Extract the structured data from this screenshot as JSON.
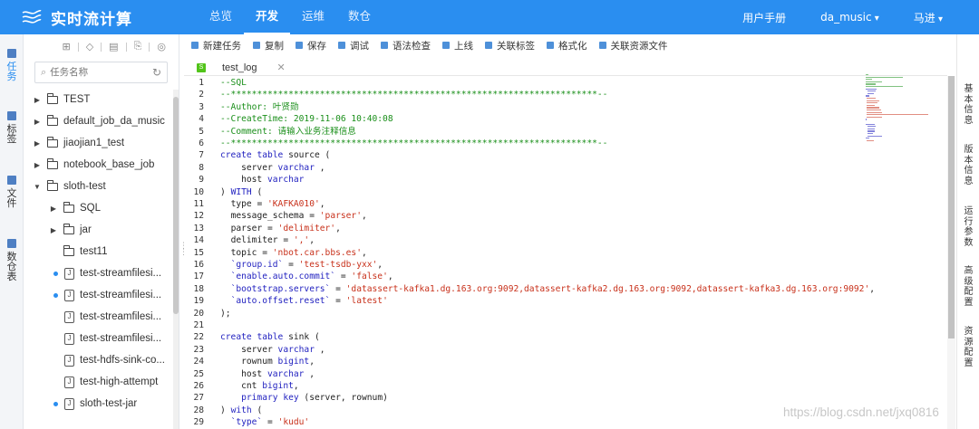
{
  "app": {
    "title": "实时流计算"
  },
  "topnav": [
    {
      "label": "总览",
      "active": false
    },
    {
      "label": "开发",
      "active": true
    },
    {
      "label": "运维",
      "active": false
    },
    {
      "label": "数仓",
      "active": false
    }
  ],
  "header_right": {
    "manual": "用户手册",
    "project": "da_music",
    "user": "马进"
  },
  "rail": [
    {
      "label": "任务",
      "icon": "task-icon",
      "active": true
    },
    {
      "label": "标签",
      "icon": "tag-icon",
      "active": false
    },
    {
      "label": "文件",
      "icon": "file-icon",
      "active": false
    },
    {
      "label": "数仓表",
      "icon": "table-icon",
      "active": false
    }
  ],
  "tree": {
    "search_placeholder": "任务名称",
    "nodes": [
      {
        "label": "TEST",
        "kind": "folder",
        "expanded": false,
        "depth": 0
      },
      {
        "label": "default_job_da_music",
        "kind": "folder",
        "expanded": false,
        "depth": 0
      },
      {
        "label": "jiaojian1_test",
        "kind": "folder",
        "expanded": false,
        "depth": 0
      },
      {
        "label": "notebook_base_job",
        "kind": "folder",
        "expanded": false,
        "depth": 0
      },
      {
        "label": "sloth-test",
        "kind": "folder",
        "expanded": true,
        "depth": 0
      },
      {
        "label": "SQL",
        "kind": "folder",
        "expanded": false,
        "depth": 1
      },
      {
        "label": "jar",
        "kind": "folder",
        "expanded": false,
        "depth": 1
      },
      {
        "label": "test11",
        "kind": "folder-leaf",
        "depth": 1
      },
      {
        "label": "test-streamfilesi...",
        "kind": "file",
        "dot": true,
        "depth": 1
      },
      {
        "label": "test-streamfilesi...",
        "kind": "file",
        "dot": true,
        "depth": 1
      },
      {
        "label": "test-streamfilesi...",
        "kind": "file",
        "dot": false,
        "depth": 1
      },
      {
        "label": "test-streamfilesi...",
        "kind": "file",
        "dot": false,
        "depth": 1
      },
      {
        "label": "test-hdfs-sink-co...",
        "kind": "file",
        "dot": false,
        "depth": 1
      },
      {
        "label": "test-high-attempt",
        "kind": "file",
        "dot": false,
        "depth": 1
      },
      {
        "label": "sloth-test-jar",
        "kind": "file",
        "dot": true,
        "depth": 1
      }
    ]
  },
  "toolbar": [
    {
      "label": "新建任务"
    },
    {
      "label": "复制"
    },
    {
      "label": "保存"
    },
    {
      "label": "调试"
    },
    {
      "label": "语法检查"
    },
    {
      "label": "上线"
    },
    {
      "label": "关联标签"
    },
    {
      "label": "格式化"
    },
    {
      "label": "关联资源文件"
    }
  ],
  "tab": {
    "label": "test_log",
    "icon_text": "S"
  },
  "code_lines": [
    "--SQL",
    "--**********************************************************************--",
    "--Author: 叶贤勋",
    "--CreateTime: 2019-11-06 10:40:08",
    "--Comment: 请输入业务注释信息",
    "--**********************************************************************--",
    "create table source (",
    "    server varchar ,",
    "    host varchar",
    ") WITH (",
    "  type = 'KAFKA010',",
    "  message_schema = 'parser',",
    "  parser = 'delimiter',",
    "  delimiter = ',',",
    "  topic = 'nbot.car.bbs.es',",
    "  `group.id` = 'test-tsdb-yxx',",
    "  `enable.auto.commit` = 'false',",
    "  `bootstrap.servers` = 'datassert-kafka1.dg.163.org:9092,datassert-kafka2.dg.163.org:9092,datassert-kafka3.dg.163.org:9092',",
    "  `auto.offset.reset` = 'latest'",
    ");",
    "",
    "create table sink (",
    "    server varchar ,",
    "    rownum bigint,",
    "    host varchar ,",
    "    cnt bigint,",
    "    primary key (server, rownum)",
    ") with (",
    "  `type` = 'kudu'"
  ],
  "side_tabs": [
    "基本信息",
    "版本信息",
    "运行参数",
    "高级配置",
    "资源配置"
  ],
  "watermark": "https://blog.csdn.net/jxq0816",
  "colors": {
    "brand": "#2a8ef0",
    "comment": "#1a8f1a",
    "keyword": "#1f1fbf",
    "string": "#c8311b"
  }
}
